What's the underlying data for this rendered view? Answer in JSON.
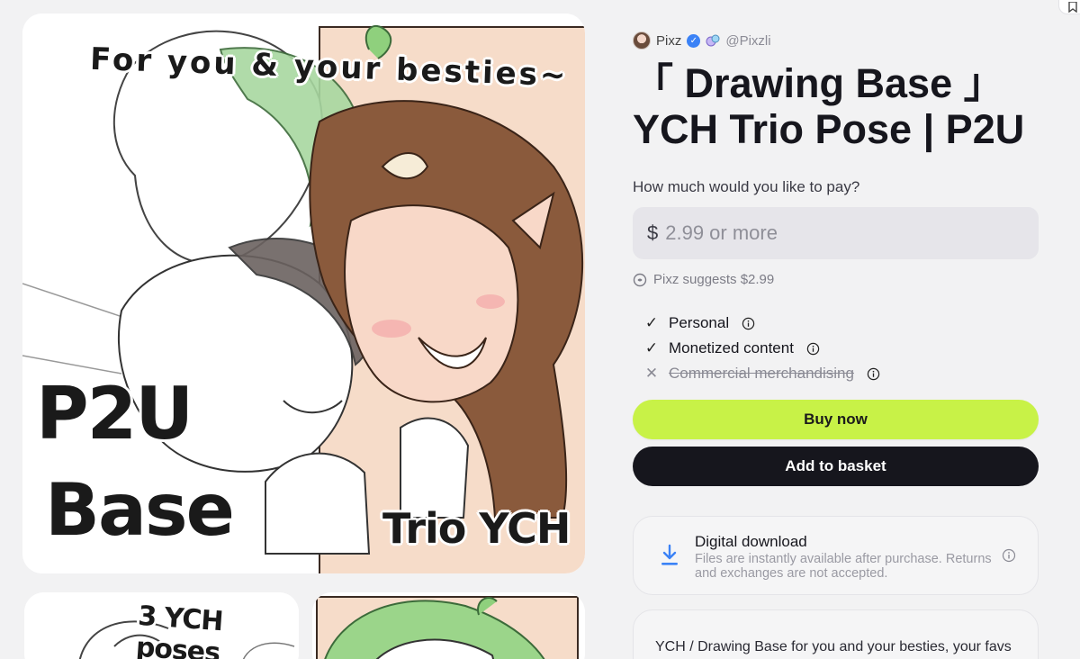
{
  "gallery": {
    "main_headline": "For you & your besties~",
    "main_badge_line1": "P2U",
    "main_badge_line2": "Base",
    "main_badge_corner": "Trio YCH",
    "thumb1_caption": "3 YCH poses"
  },
  "creator": {
    "name": "Pixz",
    "handle": "@Pixzli",
    "avatar_icon": "avatar-image",
    "verified_icon": "verified-check-icon"
  },
  "product": {
    "title": "「 Drawing Base 」YCH Trio Pose | P2U"
  },
  "pricing": {
    "question": "How much would you like to pay?",
    "currency": "$",
    "placeholder": "2.99 or more",
    "suggestion": "Pixz suggests $2.99"
  },
  "licenses": [
    {
      "label": "Personal",
      "included": true
    },
    {
      "label": "Monetized content",
      "included": true
    },
    {
      "label": "Commercial merchandising",
      "included": false
    }
  ],
  "actions": {
    "buy_label": "Buy now",
    "basket_label": "Add to basket"
  },
  "download": {
    "title": "Digital download",
    "description": "Files are instantly available after purchase. Returns and exchanges are not accepted."
  },
  "description": {
    "text": "YCH / Drawing Base for you and your besties, your favs"
  },
  "colors": {
    "accent": "#c8f247",
    "dark_button": "#16161d",
    "page_bg": "#f2f2f3",
    "download_icon": "#3b82f6"
  }
}
